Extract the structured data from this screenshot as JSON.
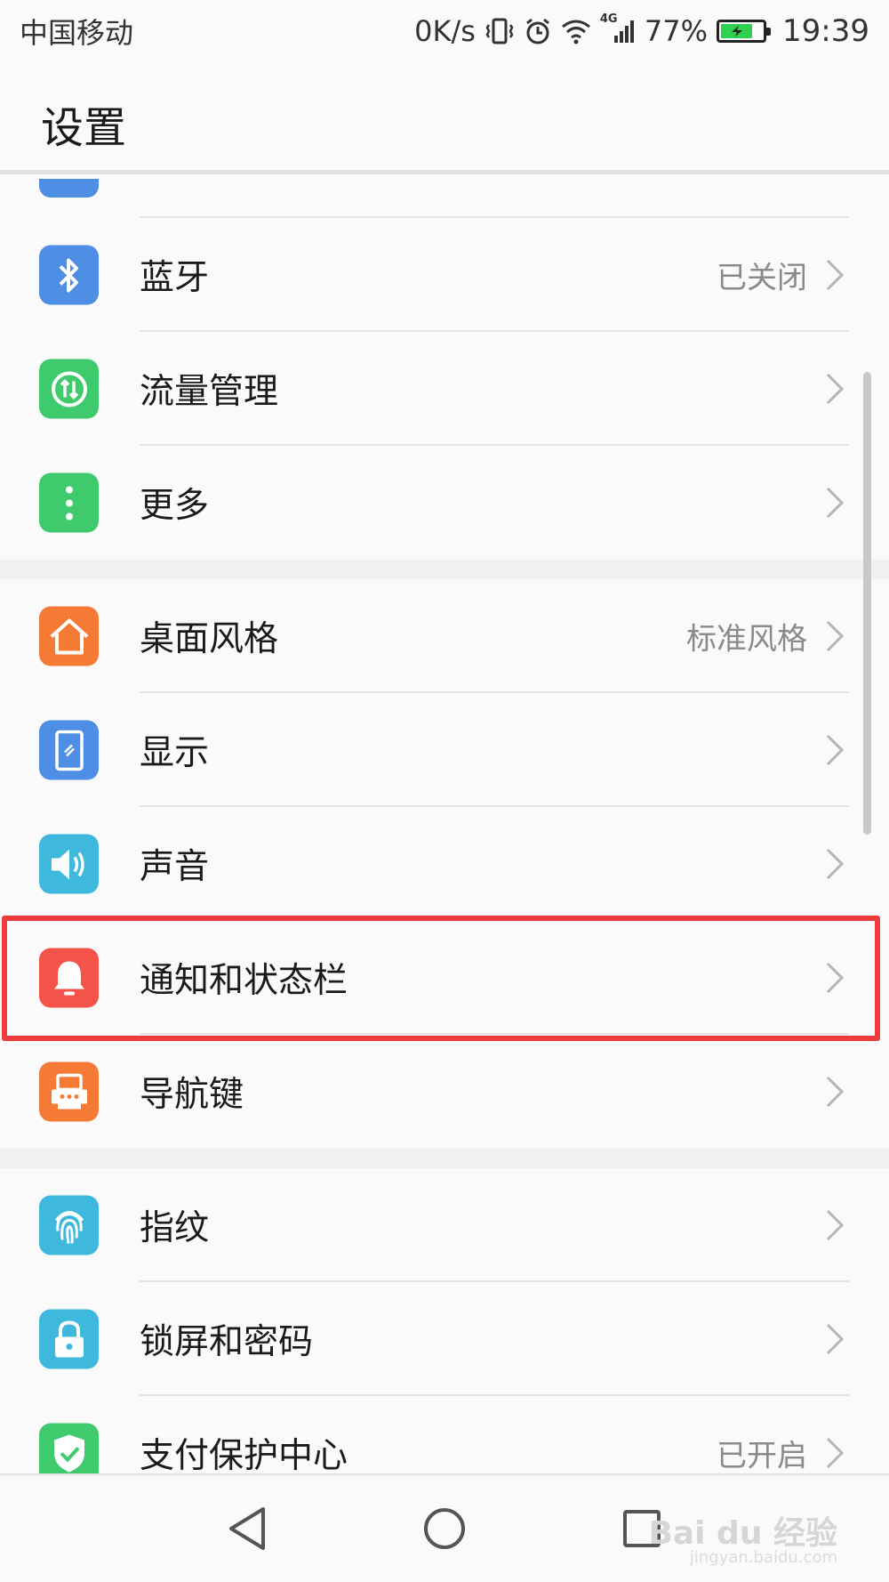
{
  "status_bar": {
    "carrier": "中国移动",
    "net_speed": "0K/s",
    "network_type": "4G",
    "battery_percent": "77%",
    "time": "19:39"
  },
  "header": {
    "title": "设置"
  },
  "groups": [
    {
      "items": [
        {
          "label": "蓝牙",
          "value": "已关闭",
          "icon": "bluetooth-icon",
          "color": "#4e8ee4"
        },
        {
          "label": "流量管理",
          "value": "",
          "icon": "data-usage-icon",
          "color": "#3fcb6d"
        },
        {
          "label": "更多",
          "value": "",
          "icon": "more-vertical-icon",
          "color": "#3fcb6d"
        }
      ]
    },
    {
      "items": [
        {
          "label": "桌面风格",
          "value": "标准风格",
          "icon": "home-icon",
          "color": "#f57b35"
        },
        {
          "label": "显示",
          "value": "",
          "icon": "display-icon",
          "color": "#4e8ee4"
        },
        {
          "label": "声音",
          "value": "",
          "icon": "speaker-icon",
          "color": "#3eb8dc"
        },
        {
          "label": "通知和状态栏",
          "value": "",
          "icon": "bell-icon",
          "color": "#f5524a"
        },
        {
          "label": "导航键",
          "value": "",
          "icon": "navigation-keys-icon",
          "color": "#f57b35"
        }
      ]
    },
    {
      "items": [
        {
          "label": "指纹",
          "value": "",
          "icon": "fingerprint-icon",
          "color": "#3eb8dc"
        },
        {
          "label": "锁屏和密码",
          "value": "",
          "icon": "lock-icon",
          "color": "#3eb8dc"
        },
        {
          "label": "支付保护中心",
          "value": "已开启",
          "icon": "shield-check-icon",
          "color": "#3fcb6d"
        }
      ]
    }
  ],
  "watermark": {
    "text": "Bai du 经验",
    "sub": "jingyan.baidu.com"
  }
}
